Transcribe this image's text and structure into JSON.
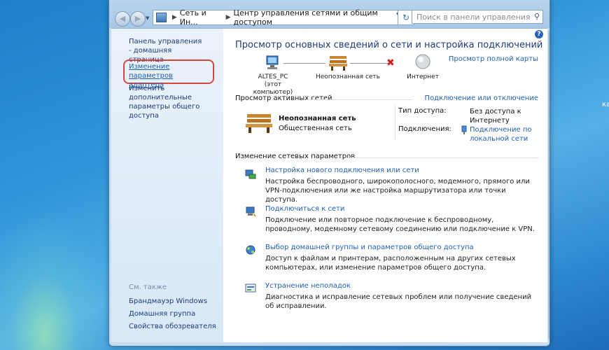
{
  "desktop": {
    "side_text": "ка"
  },
  "address_bar": {
    "crumbs": [
      "Сеть и Ин...",
      "Центр управления сетями и общим доступом"
    ]
  },
  "search": {
    "placeholder": "Поиск в панели управления"
  },
  "sidebar": {
    "home": "Панель управления - домашняя страница",
    "adapter": "Изменение параметров адаптера",
    "sharing": "Изменить дополнительные параметры общего доступа",
    "see_also_title": "См. также",
    "see_also": [
      "Брандмауэр Windows",
      "Домашняя группа",
      "Свойства обозревателя"
    ]
  },
  "main": {
    "title": "Просмотр основных сведений о сети и настройка подключений",
    "full_map": "Просмотр полной карты",
    "map": {
      "computer_name": "ALTES_PC",
      "computer_sub": "(этот компьютер)",
      "network": "Неопознанная сеть",
      "internet": "Интернет"
    },
    "active_header": "Просмотр активных сетей",
    "connect_disconnect": "Подключение или отключение",
    "active_network": {
      "name": "Неопознанная сеть",
      "type": "Общественная сеть",
      "access_label": "Тип доступа:",
      "access_value": "Без доступа к Интернету",
      "connections_label": "Подключения:",
      "connections_value": "Подключение по локальной сети"
    },
    "change_header": "Изменение сетевых параметров",
    "tasks": [
      {
        "title": "Настройка нового подключения или сети",
        "desc": "Настройка беспроводного, широкополосного, модемного, прямого или VPN-подключения или же настройка маршрутизатора или точки доступа."
      },
      {
        "title": "Подключиться к сети",
        "desc": "Подключение или повторное подключение к беспроводному, проводному, модемному сетевому соединению или подключение к VPN."
      },
      {
        "title": "Выбор домашней группы и параметров общего доступа",
        "desc": "Доступ к файлам и принтерам, расположенным на других сетевых компьютерах, или изменение параметров общего доступа."
      },
      {
        "title": "Устранение неполадок",
        "desc": "Диагностика и исправление сетевых проблем или получение сведений об исправлении."
      }
    ]
  },
  "colors": {
    "link": "#1f5fb0",
    "title": "#1e3b78",
    "highlight_ring": "#d8453e"
  }
}
